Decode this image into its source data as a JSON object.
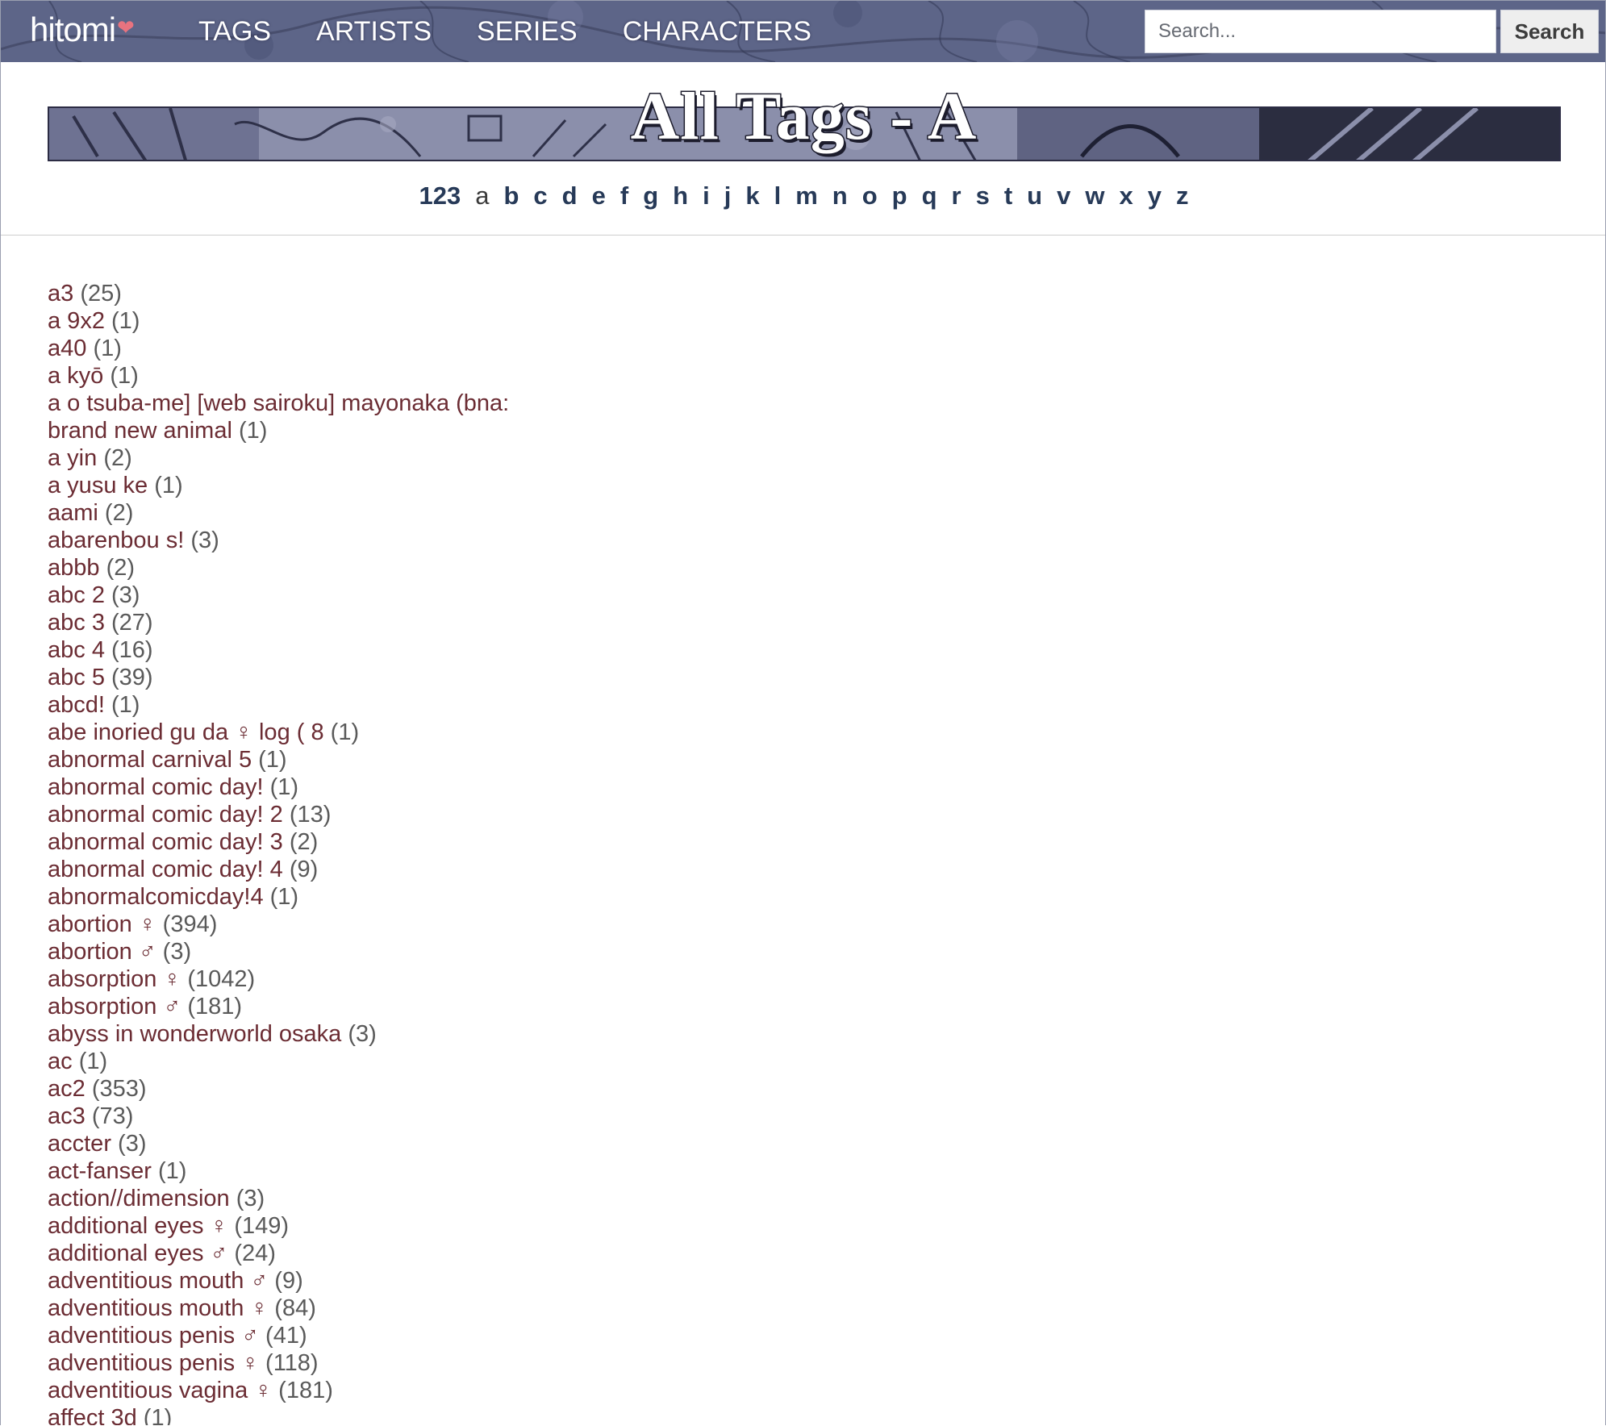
{
  "header": {
    "logo_text": "hitomi",
    "logo_heart": "❤",
    "nav": [
      {
        "label": "TAGS"
      },
      {
        "label": "ARTISTS"
      },
      {
        "label": "SERIES"
      },
      {
        "label": "CHARACTERS"
      }
    ],
    "search": {
      "placeholder": "Search...",
      "button_label": "Search"
    },
    "colors": {
      "navbar": "#5c6488",
      "heart": "#e8737f"
    }
  },
  "page": {
    "title": "All Tags - A"
  },
  "alphabet": {
    "current": "a",
    "letters": [
      "123",
      "a",
      "b",
      "c",
      "d",
      "e",
      "f",
      "g",
      "h",
      "i",
      "j",
      "k",
      "l",
      "m",
      "n",
      "o",
      "p",
      "q",
      "r",
      "s",
      "t",
      "u",
      "v",
      "w",
      "x",
      "y",
      "z"
    ]
  },
  "tags": [
    {
      "name": "a3",
      "count": "(25)"
    },
    {
      "name": "a 9x2",
      "count": "(1)"
    },
    {
      "name": "a40",
      "count": "(1)"
    },
    {
      "name": "a kyō",
      "count": "(1)"
    },
    {
      "name": "a o tsuba-me] [web sairoku] mayonaka (bna: brand new animal",
      "count": "(1)"
    },
    {
      "name": "a yin",
      "count": "(2)"
    },
    {
      "name": "a yusu ke",
      "count": "(1)"
    },
    {
      "name": "aami",
      "count": "(2)"
    },
    {
      "name": "abarenbou s!",
      "count": "(3)"
    },
    {
      "name": "abbb",
      "count": "(2)"
    },
    {
      "name": "abc 2",
      "count": "(3)"
    },
    {
      "name": "abc 3",
      "count": "(27)"
    },
    {
      "name": "abc 4",
      "count": "(16)"
    },
    {
      "name": "abc 5",
      "count": "(39)"
    },
    {
      "name": "abcd!",
      "count": "(1)"
    },
    {
      "name": "abe inoried gu da ♀ log ( 8",
      "count": "(1)"
    },
    {
      "name": "abnormal carnival 5",
      "count": "(1)"
    },
    {
      "name": "abnormal comic day!",
      "count": "(1)"
    },
    {
      "name": "abnormal comic day! 2",
      "count": "(13)"
    },
    {
      "name": "abnormal comic day! 3",
      "count": "(2)"
    },
    {
      "name": "abnormal comic day! 4",
      "count": "(9)"
    },
    {
      "name": "abnormalcomicday!4",
      "count": "(1)"
    },
    {
      "name": "abortion ♀",
      "count": "(394)"
    },
    {
      "name": "abortion ♂",
      "count": "(3)"
    },
    {
      "name": "absorption ♀",
      "count": "(1042)"
    },
    {
      "name": "absorption ♂",
      "count": "(181)"
    },
    {
      "name": "abyss in wonderworld osaka",
      "count": "(3)"
    },
    {
      "name": "ac",
      "count": "(1)"
    },
    {
      "name": "ac2",
      "count": "(353)"
    },
    {
      "name": "ac3",
      "count": "(73)"
    },
    {
      "name": "accter",
      "count": "(3)"
    },
    {
      "name": "act-fanser",
      "count": "(1)"
    },
    {
      "name": "action//dimension",
      "count": "(3)"
    },
    {
      "name": "additional eyes ♀",
      "count": "(149)"
    },
    {
      "name": "additional eyes ♂",
      "count": "(24)"
    },
    {
      "name": "adventitious mouth ♂",
      "count": "(9)"
    },
    {
      "name": "adventitious mouth ♀",
      "count": "(84)"
    },
    {
      "name": "adventitious penis ♂",
      "count": "(41)"
    },
    {
      "name": "adventitious penis ♀",
      "count": "(118)"
    },
    {
      "name": "adventitious vagina ♀",
      "count": "(181)"
    },
    {
      "name": "affect 3d",
      "count": "(1)"
    }
  ]
}
